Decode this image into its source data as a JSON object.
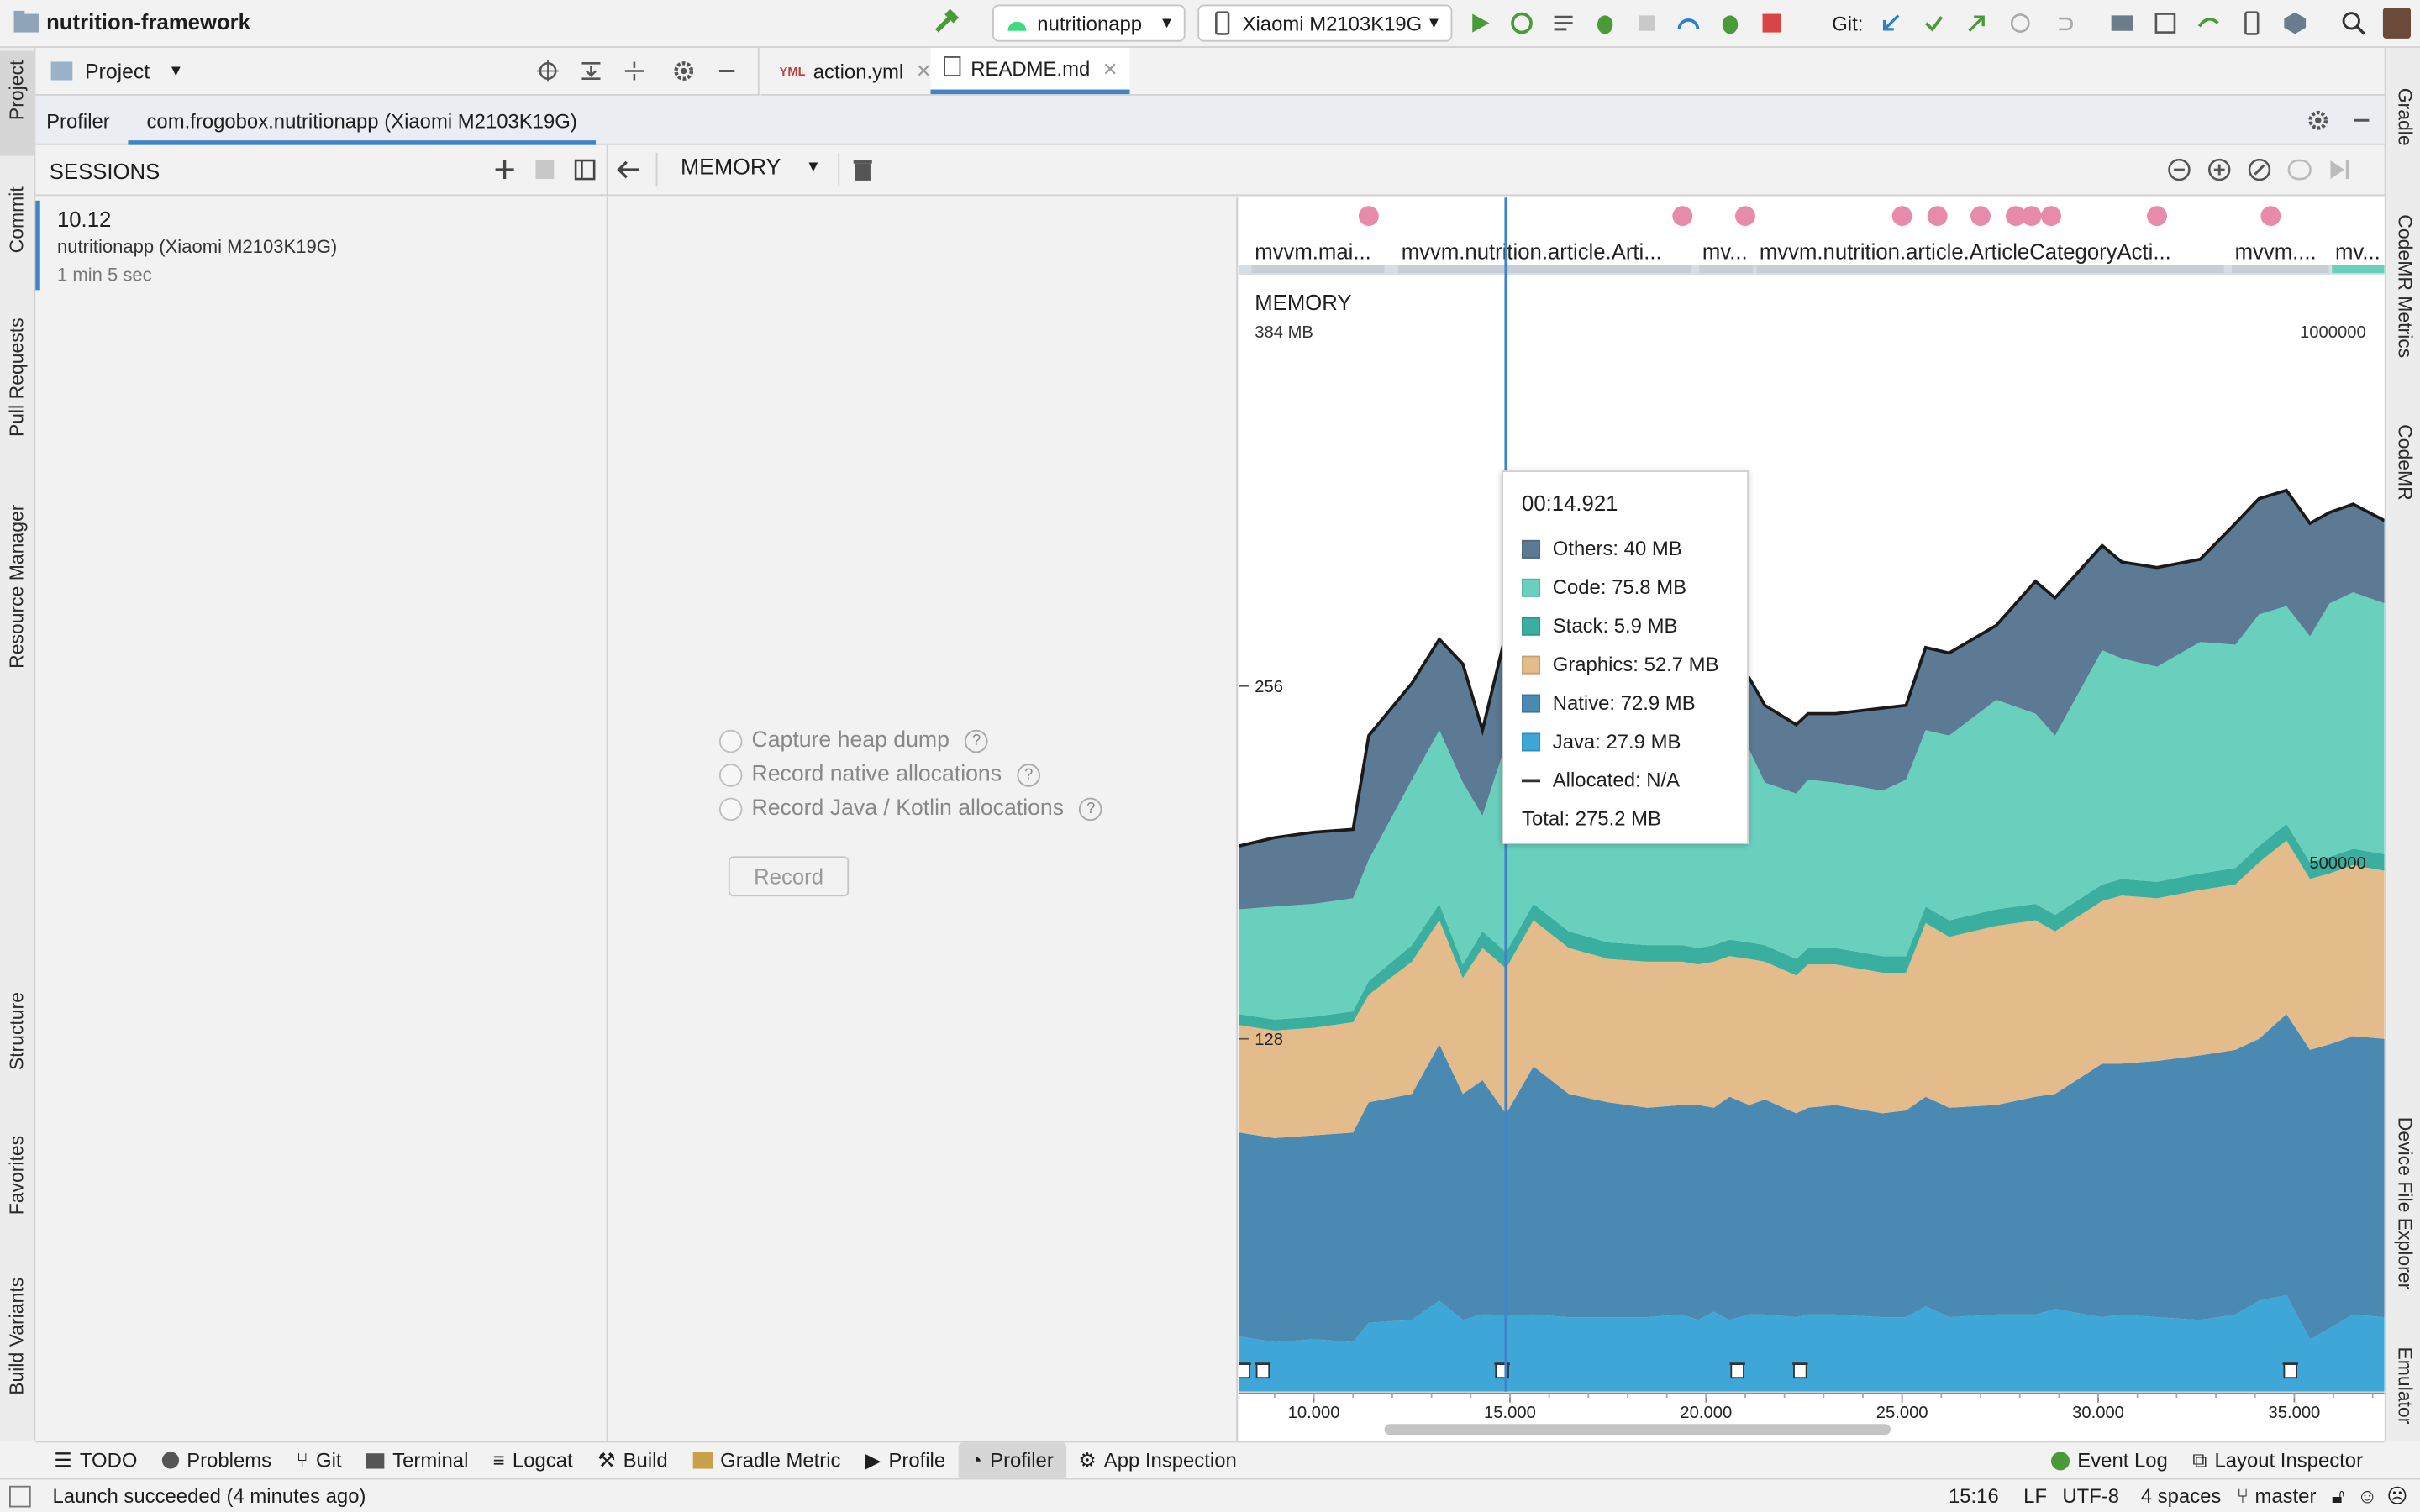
{
  "window": {
    "project_name": "nutrition-framework"
  },
  "toolbar": {
    "run_config": "nutritionapp",
    "device": "Xiaomi M2103K19G",
    "git_label": "Git:"
  },
  "project_panel": {
    "title": "Project"
  },
  "editor_tabs": [
    {
      "label": "action.yml",
      "badge": "YML"
    },
    {
      "label": "README.md"
    }
  ],
  "left_stripe": [
    "Project",
    "Commit",
    "Pull Requests",
    "Resource Manager",
    "Structure",
    "Favorites",
    "Build Variants"
  ],
  "right_stripe": [
    "Gradle",
    "CodeMR Metrics",
    "CodeMR",
    "Device File Explorer",
    "Emulator"
  ],
  "profiler": {
    "tabs": [
      "Profiler",
      "com.frogobox.nutritionapp (Xiaomi M2103K19G)"
    ],
    "sessions_title": "SESSIONS",
    "session": {
      "name": "10.12",
      "device": "nutritionapp (Xiaomi M2103K19G)",
      "duration": "1 min 5 sec"
    },
    "memory_dropdown": "MEMORY",
    "options": [
      "Capture heap dump",
      "Record native allocations",
      "Record Java / Kotlin allocations"
    ],
    "record_button": "Record",
    "activity_labels": [
      "mvvm.mai...",
      "mvvm.nutrition.article.Arti...",
      "mv...",
      "mvvm.nutrition.article.ArticleCategoryActi...",
      "mvvm....",
      "mv..."
    ]
  },
  "chart_data": {
    "type": "area",
    "title": "MEMORY",
    "left_axis": {
      "unit": "MB",
      "ticks": [
        128,
        256
      ],
      "max_label": "384 MB",
      "ylim": [
        0,
        384
      ]
    },
    "right_axis": {
      "ticks": [
        500000
      ],
      "max_label": "1000000",
      "ylim": [
        0,
        1000000
      ]
    },
    "x_ticks": [
      "10.000",
      "15.000",
      "20.000",
      "25.000",
      "30.000",
      "35.000"
    ],
    "xlim": [
      8.1,
      37.3
    ],
    "stack_order": [
      "Java",
      "Native",
      "Graphics",
      "Stack",
      "Code",
      "Others"
    ],
    "colors": {
      "Java": "#3ea7d8",
      "Native": "#4a89b2",
      "Graphics": "#e4bc8b",
      "Stack": "#3aaf9f",
      "Code": "#6ad0be",
      "Others": "#5c7a93",
      "Total": "#1a1a1a"
    },
    "x": [
      8.1,
      9.0,
      10.0,
      11.0,
      11.4,
      12.5,
      13.2,
      13.8,
      14.3,
      14.9,
      15.6,
      16.5,
      17.5,
      18.5,
      19.4,
      19.8,
      20.2,
      20.6,
      21.1,
      21.5,
      22.3,
      22.6,
      23.3,
      24.5,
      25.1,
      25.6,
      26.2,
      27.4,
      28.4,
      28.9,
      30.1,
      30.6,
      31.5,
      32.6,
      33.5,
      34.1,
      34.8,
      35.4,
      35.9,
      36.5,
      37.3
    ],
    "series": [
      {
        "name": "Java",
        "values": [
          20,
          18,
          19,
          18,
          25,
          26,
          33,
          26,
          28,
          27.9,
          28,
          27,
          27,
          27,
          28,
          26,
          29,
          26,
          28,
          28,
          27,
          28,
          28,
          27,
          27,
          31,
          27,
          28,
          28,
          30,
          27,
          28,
          27,
          26,
          28,
          33,
          35,
          19,
          23,
          28,
          27
        ]
      },
      {
        "name": "Native",
        "values": [
          74,
          74,
          74,
          76,
          80,
          82,
          93,
          82,
          85,
          72.9,
          90,
          81,
          78,
          76,
          76,
          78,
          74,
          81,
          76,
          78,
          74,
          75,
          76,
          74,
          75,
          76,
          76,
          76,
          79,
          78,
          92,
          91,
          93,
          96,
          96,
          95,
          102,
          105,
          103,
          101,
          101
        ]
      },
      {
        "name": "Graphics",
        "values": [
          39,
          39,
          39,
          40,
          39,
          48,
          45,
          42,
          48,
          52.7,
          53,
          53,
          52,
          53,
          52,
          51,
          53,
          51,
          53,
          50,
          50,
          52,
          51,
          51,
          50,
          63,
          62,
          65,
          64,
          59,
          59,
          61,
          59,
          60,
          60,
          64,
          63,
          62,
          62,
          62,
          61
        ]
      },
      {
        "name": "Stack",
        "values": [
          4,
          4,
          4,
          4,
          5,
          6,
          6,
          5,
          6,
          5.9,
          6,
          6,
          6,
          6,
          6,
          6,
          6,
          6,
          6,
          6,
          6,
          6,
          6,
          6,
          6,
          6,
          6,
          6,
          6,
          6,
          6,
          6,
          6,
          6,
          6,
          6,
          6,
          6,
          6,
          6,
          6
        ]
      },
      {
        "name": "Code",
        "values": [
          38,
          41,
          41,
          41,
          44,
          60,
          63,
          66,
          42,
          75.8,
          70,
          68,
          67,
          66,
          67,
          70,
          68,
          73,
          70,
          59,
          60,
          61,
          60,
          60,
          64,
          64,
          67,
          76,
          69,
          65,
          85,
          80,
          78,
          84,
          81,
          84,
          79,
          82,
          92,
          93,
          91
        ]
      },
      {
        "name": "Others",
        "values": [
          23,
          25,
          26,
          25,
          45,
          35,
          33,
          43,
          31,
          40,
          34,
          33,
          34,
          36,
          37,
          38,
          36,
          30,
          26,
          28,
          25,
          24,
          25,
          30,
          27,
          30,
          30,
          27,
          48,
          50,
          38,
          35,
          36,
          30,
          44,
          42,
          42,
          41,
          33,
          32,
          30
        ]
      }
    ],
    "tooltip": {
      "time": "00:14.921",
      "rows": [
        "Others: 40 MB",
        "Code: 75.8 MB",
        "Stack: 5.9 MB",
        "Graphics: 52.7 MB",
        "Native: 72.9 MB",
        "Java: 27.9 MB"
      ],
      "allocated": "Allocated: N/A",
      "total": "Total: 275.2 MB"
    },
    "cursor_x": 14.9,
    "event_dots_x": [
      11.4,
      19.4,
      21.0,
      25.0,
      25.9,
      27.0,
      27.9,
      28.3,
      28.8,
      31.5,
      34.4
    ],
    "gc_marks_x": [
      8.2,
      8.7,
      14.8,
      20.8,
      22.4,
      34.9
    ]
  },
  "bottom_tabs": [
    "TODO",
    "Problems",
    "Git",
    "Terminal",
    "Logcat",
    "Build",
    "Gradle Metric",
    "Profile",
    "Profiler",
    "App Inspection"
  ],
  "bottom_right_tabs": [
    "Event Log",
    "Layout Inspector"
  ],
  "status": {
    "message": "Launch succeeded (4 minutes ago)",
    "position": "15:16",
    "line_sep": "LF",
    "encoding": "UTF-8",
    "indent": "4 spaces",
    "branch": "master"
  }
}
